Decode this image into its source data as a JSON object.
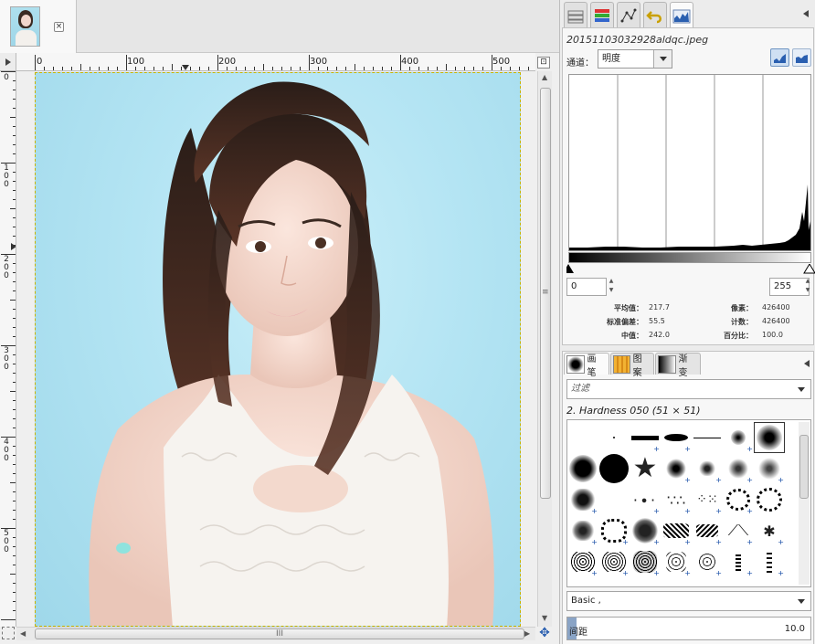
{
  "image_window": {
    "tab_close_glyph": "×",
    "h_ruler_labels": [
      "0",
      "100",
      "200",
      "300",
      "400",
      "500"
    ],
    "v_ruler_labels": [
      "0",
      "100",
      "200",
      "300",
      "400",
      "500"
    ],
    "h_scroll_grip": "III",
    "v_scroll_grip": "≡"
  },
  "histogram": {
    "filename": "20151103032928aldqc.jpeg",
    "channel_label": "通道：",
    "channel_value": "明度",
    "range_start": "0",
    "range_end": "255",
    "stats": {
      "mean_label": "平均值：",
      "mean_value": "217.7",
      "stddev_label": "标准偏差：",
      "stddev_value": "55.5",
      "median_label": "中值：",
      "median_value": "242.0",
      "pixels_label": "像素：",
      "pixels_value": "426400",
      "count_label": "计数：",
      "count_value": "426400",
      "percentile_label": "百分比：",
      "percentile_value": "100.0"
    }
  },
  "brushes": {
    "tabs": [
      {
        "label": "画笔"
      },
      {
        "label": "图案"
      },
      {
        "label": "渐变"
      }
    ],
    "filter_placeholder": "过滤",
    "selected_brush": "2. Hardness 050 (51 × 51)",
    "preset": "Basic ,",
    "spacing_label": "间距",
    "spacing_value": "10.0"
  },
  "colors": {
    "accent": "#2a5fb0",
    "background_blue": "#b3e4f3",
    "panel": "#ececec"
  },
  "icons": {
    "dock_tabs": [
      "tool-options-icon",
      "layers-icon",
      "paths-icon",
      "undo-history-icon",
      "histogram-icon"
    ]
  }
}
